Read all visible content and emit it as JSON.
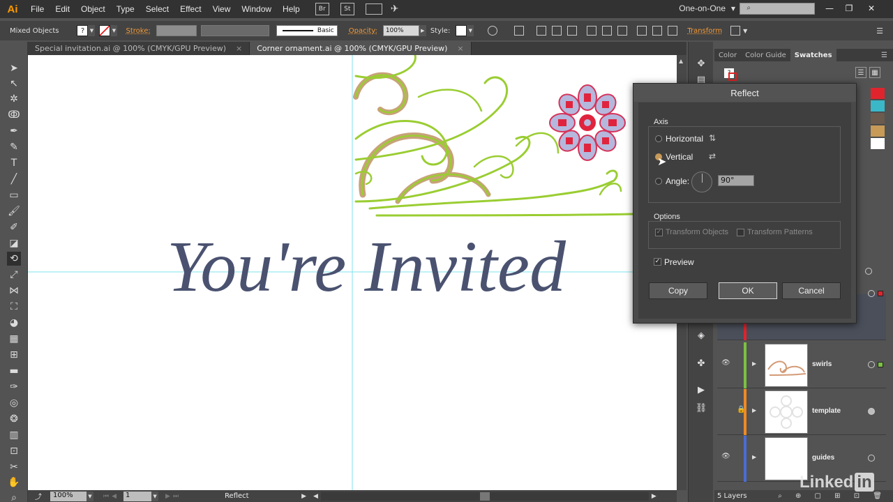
{
  "app": {
    "logo": "Ai"
  },
  "menu": [
    "File",
    "Edit",
    "Object",
    "Type",
    "Select",
    "Effect",
    "View",
    "Window",
    "Help"
  ],
  "menu_boxes": [
    "Br",
    "St"
  ],
  "workspace": "One-on-One",
  "window_controls": {
    "minimize": "—",
    "restore": "❐",
    "close": "✕"
  },
  "control": {
    "selection": "Mixed Objects",
    "stroke_label": "Stroke:",
    "brush": "Basic",
    "opacity_label": "Opacity:",
    "opacity_value": "100%",
    "style_label": "Style:",
    "transform_label": "Transform"
  },
  "tabs": [
    {
      "label": "Special invitation.ai @ 100% (CMYK/GPU Preview)",
      "close": "×"
    },
    {
      "label": "Corner ornament.ai @ 100% (CMYK/GPU Preview)",
      "close": "×"
    }
  ],
  "canvas": {
    "headline": "You're Invited",
    "headline_color": "#4a5270"
  },
  "status": {
    "zoom": "100%",
    "artboard": "1",
    "tool": "Reflect"
  },
  "panel_tabs": [
    "Color",
    "Color Guide",
    "Swatches"
  ],
  "swatch_colors": [
    "#e0242e",
    "#3ab8c8",
    "#6b5a4e",
    "#c79a58",
    "#ffffff"
  ],
  "layers": [
    {
      "name": "",
      "color": "#e0242e"
    },
    {
      "name": "swirls",
      "color": "#7bc043"
    },
    {
      "name": "template",
      "color": "#f08a24"
    },
    {
      "name": "guides",
      "color": "#4a6cd4"
    }
  ],
  "layers_count": "5 Layers",
  "dialog": {
    "title": "Reflect",
    "axis_label": "Axis",
    "horizontal": "Horizontal",
    "vertical": "Vertical",
    "angle_label": "Angle:",
    "angle_value": "90°",
    "options_label": "Options",
    "transform_objects": "Transform Objects",
    "transform_patterns": "Transform Patterns",
    "preview": "Preview",
    "copy": "Copy",
    "ok": "OK",
    "cancel": "Cancel"
  },
  "watermark": {
    "linked": "Linked",
    "in": "in"
  }
}
